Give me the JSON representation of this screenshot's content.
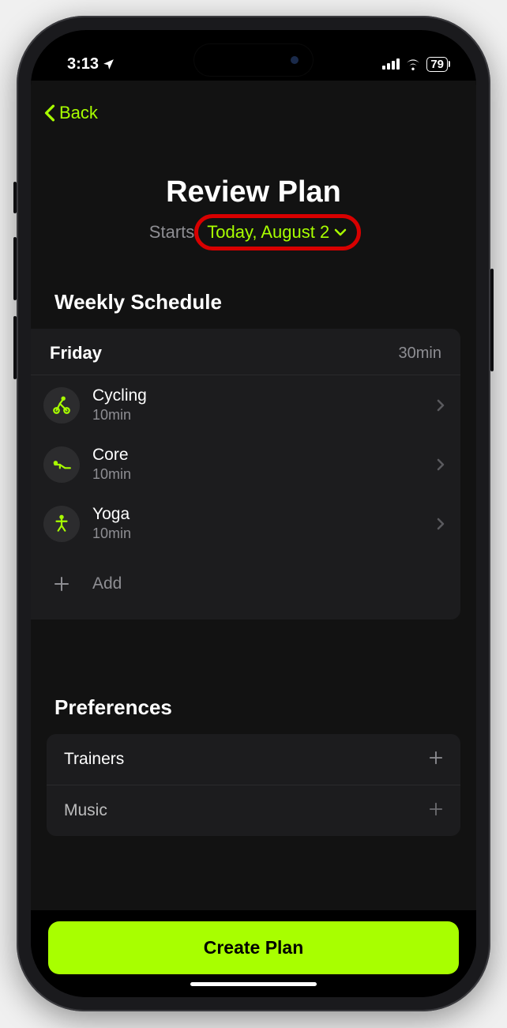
{
  "status": {
    "time": "3:13",
    "battery": "79"
  },
  "nav": {
    "back_label": "Back"
  },
  "header": {
    "title": "Review Plan",
    "starts_label": "Starts",
    "date_text": "Today, August 2"
  },
  "sections": {
    "schedule_title": "Weekly Schedule",
    "preferences_title": "Preferences"
  },
  "schedule": {
    "day": "Friday",
    "total": "30min",
    "workouts": [
      {
        "name": "Cycling",
        "duration": "10min",
        "icon": "cycling"
      },
      {
        "name": "Core",
        "duration": "10min",
        "icon": "core"
      },
      {
        "name": "Yoga",
        "duration": "10min",
        "icon": "yoga"
      }
    ],
    "add_label": "Add"
  },
  "preferences": {
    "rows": [
      {
        "label": "Trainers"
      },
      {
        "label": "Music"
      }
    ]
  },
  "footer": {
    "create_label": "Create Plan"
  },
  "colors": {
    "accent": "#a8ff00",
    "annotation": "#d80000"
  }
}
